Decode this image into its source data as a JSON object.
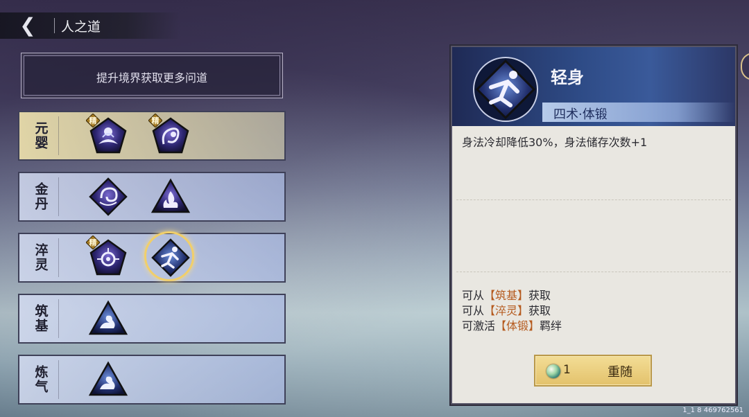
{
  "header": {
    "back_icon": "back-arrow-icon",
    "title": "人之道"
  },
  "hint": {
    "text": "提升境界获取更多问道"
  },
  "rows": [
    {
      "label": "元婴",
      "highlight": true,
      "icons": [
        {
          "icon": "meditation-pentagon-icon",
          "badge": "精"
        },
        {
          "icon": "spiral-figure-pentagon-icon",
          "badge": "精"
        }
      ]
    },
    {
      "label": "金丹",
      "highlight": false,
      "icons": [
        {
          "icon": "swirl-diamond-icon",
          "badge": ""
        },
        {
          "icon": "flame-triangle-icon",
          "badge": ""
        }
      ]
    },
    {
      "label": "淬灵",
      "highlight": false,
      "icons": [
        {
          "icon": "lotus-pentagon-icon",
          "badge": "精"
        },
        {
          "icon": "leaping-figure-diamond-icon",
          "badge": "",
          "selected": true
        }
      ]
    },
    {
      "label": "筑基",
      "highlight": false,
      "icons": [
        {
          "icon": "wave-triangle-icon",
          "badge": ""
        }
      ]
    },
    {
      "label": "炼气",
      "highlight": false,
      "icons": [
        {
          "icon": "wave-triangle-icon",
          "badge": ""
        }
      ]
    }
  ],
  "detail": {
    "icon": "leaping-figure-diamond-icon",
    "name": "轻身",
    "tag": "四术·体锻",
    "description": "身法冷却降低30%，身法储存次数+1",
    "sources": [
      {
        "prefix": "可从",
        "highlight": "【筑基】",
        "suffix": "获取"
      },
      {
        "prefix": "可从",
        "highlight": "【淬灵】",
        "suffix": "获取"
      },
      {
        "prefix": "可激活",
        "highlight": "【体锻】",
        "suffix": "羁绊"
      }
    ],
    "reroll": {
      "cost_icon": "spirit-orb-icon",
      "cost": "1",
      "label": "重随"
    }
  },
  "version": "1_1 8 469762561",
  "colors": {
    "highlight_text": "#b55a1e",
    "selected_ring": "#f1cf6a",
    "button_gold": "#e3c26c"
  }
}
